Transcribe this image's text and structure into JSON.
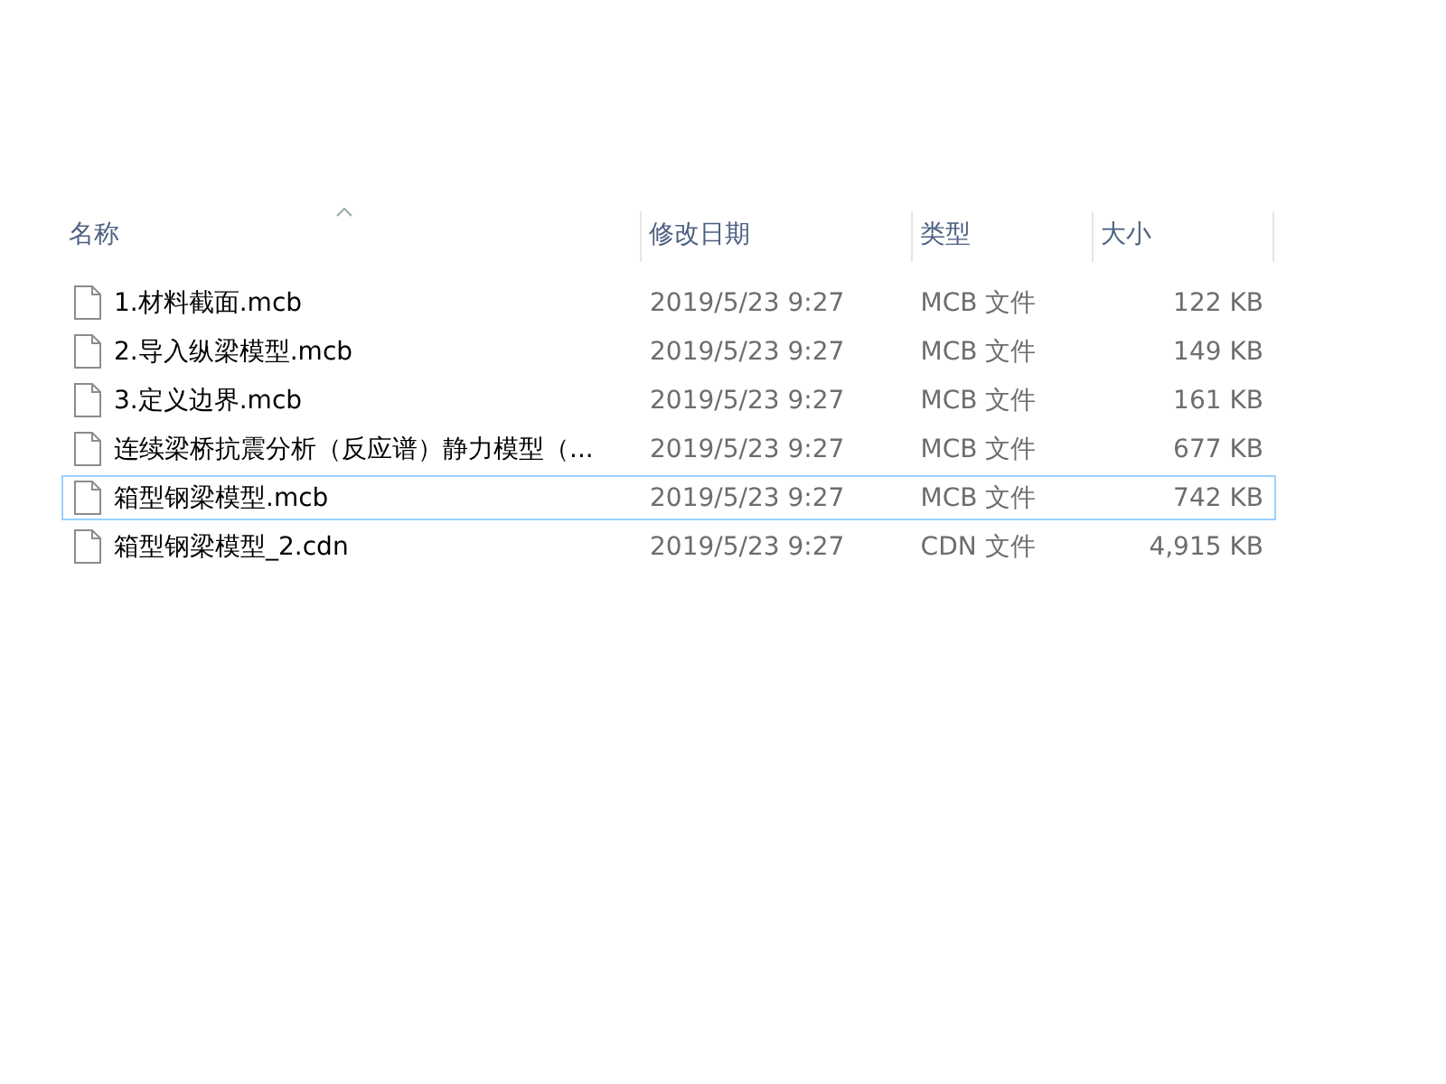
{
  "columns": [
    {
      "label": "名称",
      "sorted": true
    },
    {
      "label": "修改日期",
      "sorted": false
    },
    {
      "label": "类型",
      "sorted": false
    },
    {
      "label": "大小",
      "sorted": false
    }
  ],
  "files": [
    {
      "name": "1.材料截面.mcb",
      "date": "2019/5/23 9:27",
      "type": "MCB 文件",
      "size": "122 KB",
      "focused": false
    },
    {
      "name": "2.导入纵梁模型.mcb",
      "date": "2019/5/23 9:27",
      "type": "MCB 文件",
      "size": "149 KB",
      "focused": false
    },
    {
      "name": "3.定义边界.mcb",
      "date": "2019/5/23 9:27",
      "type": "MCB 文件",
      "size": "161 KB",
      "focused": false
    },
    {
      "name": "连续梁桥抗震分析（反应谱）静力模型（...",
      "date": "2019/5/23 9:27",
      "type": "MCB 文件",
      "size": "677 KB",
      "focused": false
    },
    {
      "name": "箱型钢梁模型.mcb",
      "date": "2019/5/23 9:27",
      "type": "MCB 文件",
      "size": "742 KB",
      "focused": true
    },
    {
      "name": "箱型钢梁模型_2.cdn",
      "date": "2019/5/23 9:27",
      "type": "CDN 文件",
      "size": "4,915 KB",
      "focused": false
    }
  ]
}
